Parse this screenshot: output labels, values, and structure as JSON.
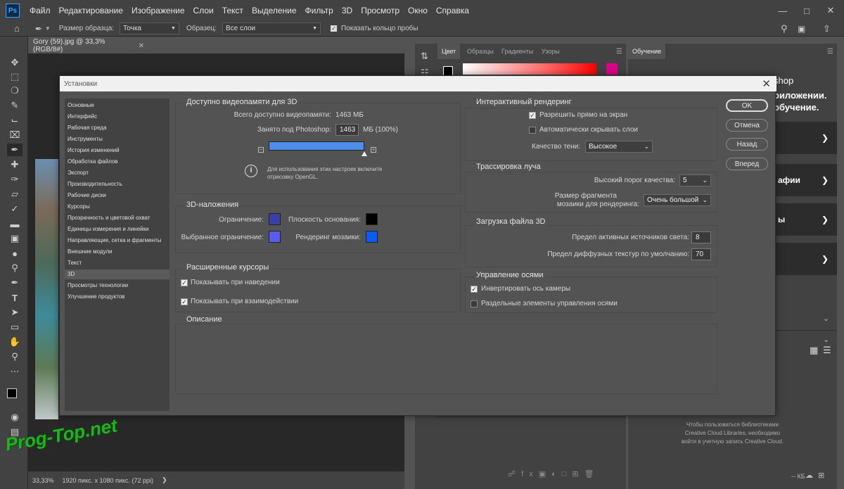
{
  "app": {
    "logo": "Ps"
  },
  "menu": [
    "Файл",
    "Редактирование",
    "Изображение",
    "Слои",
    "Текст",
    "Выделение",
    "Фильтр",
    "3D",
    "Просмотр",
    "Окно",
    "Справка"
  ],
  "options": {
    "sample_size_label": "Размер образца:",
    "sample_size_value": "Точка",
    "sample_label": "Образец:",
    "sample_value": "Все слои",
    "ring_label": "Показать кольцо пробы"
  },
  "document": {
    "tab_title": "Gory (59).jpg @ 33,3% (RGB/8#)",
    "zoom": "33,33%",
    "size": "1920 пикс. x 1080 пикс. (72 ppi)"
  },
  "panels": {
    "color_tabs": [
      "Цвет",
      "Образцы",
      "Градиенты",
      "Узоры"
    ],
    "learn_tab": "Обучение",
    "learn_text_1": "shop",
    "learn_text_2": "риложении.",
    "learn_text_3": "обучение.",
    "card_2": "афии",
    "card_3": "ы",
    "libraries_msg_1": "Чтобы пользоваться библиотеками",
    "libraries_msg_2": "Creative Cloud Libraries, необходимо",
    "libraries_msg_3": "войти в учетную запись Creative Cloud.",
    "kb": "-- КБ"
  },
  "dialog": {
    "title": "Установки",
    "categories": [
      "Основные",
      "Интерфейс",
      "Рабочая среда",
      "Инструменты",
      "История изменений",
      "Обработка файлов",
      "Экспорт",
      "Производительность",
      "Рабочие диски",
      "Курсоры",
      "Прозрачность и цветовой охват",
      "Единицы измерения и линейки",
      "Направляющие, сетка и фрагменты",
      "Внешние модули",
      "Текст",
      "3D",
      "Просмотры технологии",
      "Улучшение продуктов"
    ],
    "selected_category": "3D",
    "vram": {
      "title": "Доступно видеопамяти для 3D",
      "total_label": "Всего доступно видеопамяти:",
      "total_value": "1463 МБ",
      "used_label": "Занято под Photoshop:",
      "used_value": "1463",
      "used_unit": "МБ (100%)",
      "slider_fraction": 1.0,
      "info": "Для использования этих настроек включите отрисовку OpenGL."
    },
    "overlays": {
      "title": "3D-наложения",
      "constraint_label": "Ограничение:",
      "constraint_color": "#3a3fa8",
      "ground_label": "Плоскость основания:",
      "ground_color": "#000000",
      "selected_constraint_label": "Выбранное ограничение:",
      "selected_constraint_color": "#5a5cf0",
      "tile_label": "Рендеринг мозаики:",
      "tile_color": "#0a5cf5"
    },
    "cursors": {
      "title": "Расширенные курсоры",
      "hover_label": "Показывать при наведении",
      "hover_checked": true,
      "interact_label": "Показывать при взаимодействии",
      "interact_checked": true
    },
    "description": {
      "title": "Описание"
    },
    "interactive": {
      "title": "Интерактивный рендеринг",
      "direct_label": "Разрешить прямо на экран",
      "direct_checked": true,
      "autohide_label": "Автоматически скрывать слои",
      "autohide_checked": false,
      "shadow_label": "Качество тени:",
      "shadow_value": "Высокое"
    },
    "raytrace": {
      "title": "Трассировка луча",
      "threshold_label": "Высокий порог качества:",
      "threshold_value": "5",
      "tile_size_label_1": "Размер фрагмента",
      "tile_size_label_2": "мозаики для рендеринга:",
      "tile_size_value": "Очень большой"
    },
    "fileload": {
      "title": "Загрузка файла 3D",
      "lights_label": "Предел активных источников света:",
      "lights_value": "8",
      "textures_label": "Предел диффузных текстур по умолчанию:",
      "textures_value": "70"
    },
    "axis": {
      "title": "Управление осями",
      "invert_label": "Инвертировать ось камеры",
      "invert_checked": true,
      "separate_label": "Раздельные элементы управления осями",
      "separate_checked": false
    },
    "buttons": {
      "ok": "OK",
      "cancel": "Отмена",
      "back": "Назад",
      "forward": "Вперед"
    }
  },
  "watermark": "Prog-Top.net"
}
